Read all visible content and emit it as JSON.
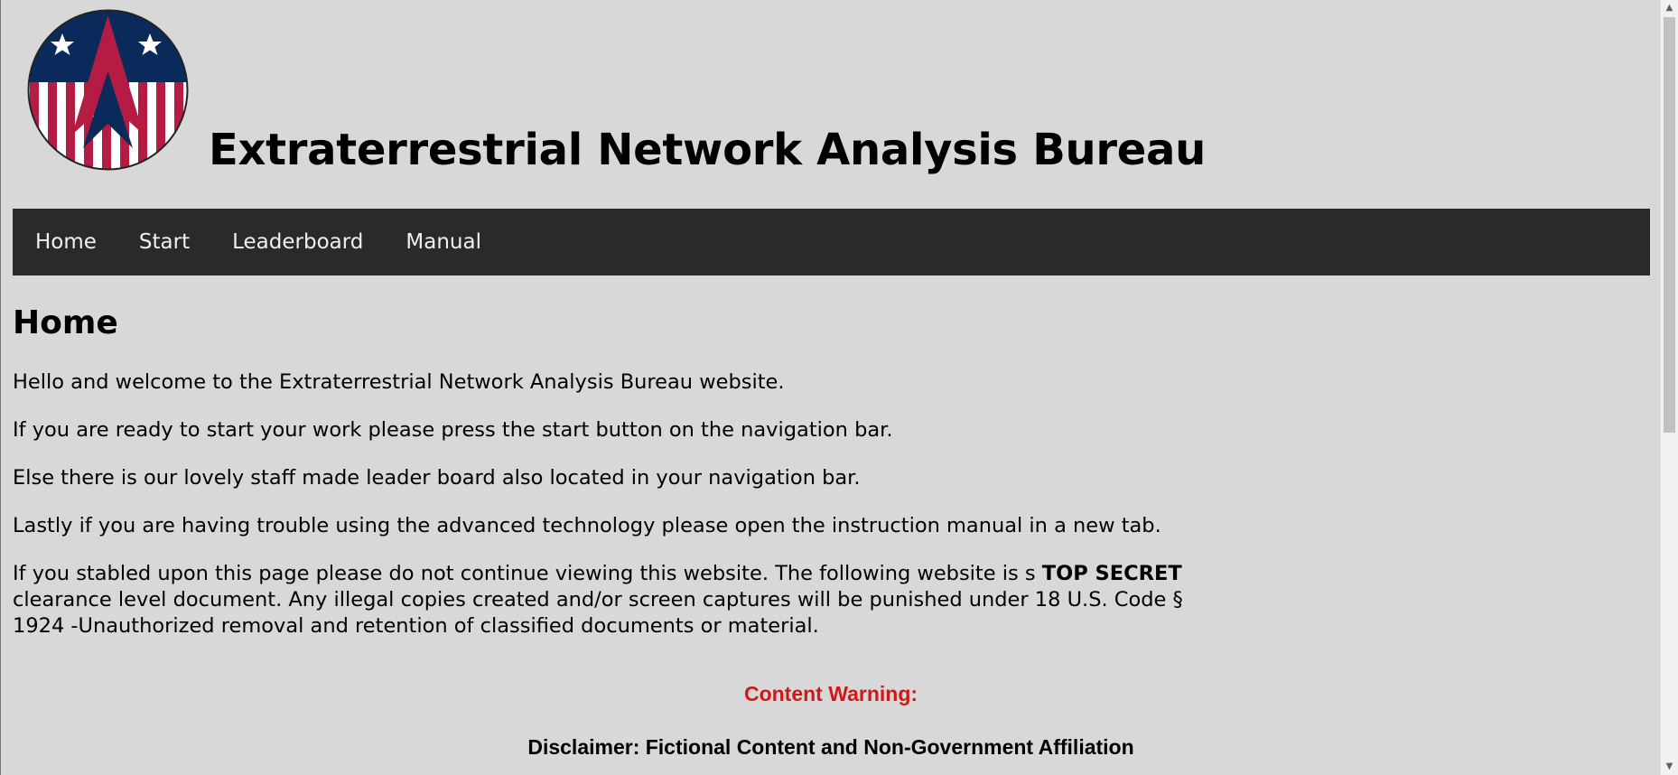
{
  "header": {
    "logo_icon": "seal-star-stripes-logo",
    "site_title": "Extraterrestrial Network Analysis Bureau"
  },
  "nav": {
    "items": [
      {
        "label": "Home"
      },
      {
        "label": "Start"
      },
      {
        "label": "Leaderboard"
      },
      {
        "label": "Manual"
      }
    ]
  },
  "main": {
    "heading": "Home",
    "p1": "Hello and welcome to the Extraterrestrial Network Analysis Bureau website.",
    "p2": "If you are ready to start your work please press the start button on the navigation bar.",
    "p3": "Else there is our lovely staff made leader board also located in your navigation bar.",
    "p4": "Lastly if you are having trouble using the advanced technology please open the instruction manual in a new tab.",
    "p5_before": "If you stabled upon this page please do not continue viewing this website. The following website is s ",
    "p5_bold": "TOP SECRET",
    "p5_after": " clearance level document. Any illegal copies created and/or screen captures will be punished under 18 U.S. Code § 1924 -Unauthorized removal and retention of classified documents or material."
  },
  "warning": {
    "title": "Content Warning:",
    "disclaimer_title": "Disclaimer: Fictional Content and Non-Government Affiliation"
  },
  "colors": {
    "background": "#d8d8d8",
    "navbar": "#2a2a2a",
    "warning_red": "#d01818",
    "logo_blue": "#0b2a5c",
    "logo_red": "#b51c43"
  }
}
